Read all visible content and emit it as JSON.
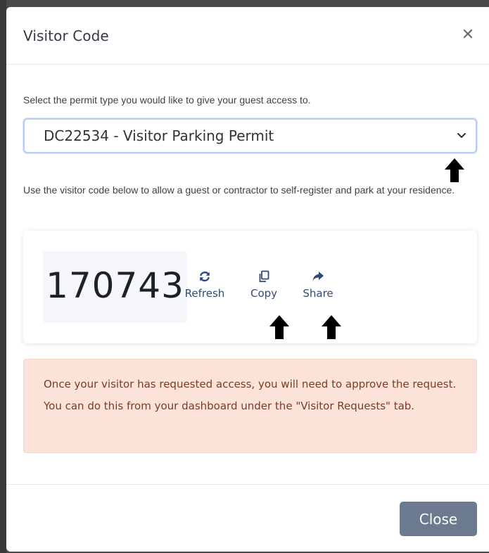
{
  "modal": {
    "title": "Visitor Code",
    "close_icon": "close-icon"
  },
  "permit": {
    "instruction": "Select the permit type you would like to give your guest access to.",
    "selected": "DC22534 - Visitor Parking Permit"
  },
  "code_section": {
    "instruction": "Use the visitor code below to allow a guest or contractor to self-register and park at your residence.",
    "code": "170743",
    "actions": [
      {
        "label": "Refresh",
        "icon": "refresh-icon"
      },
      {
        "label": "Copy",
        "icon": "copy-icon"
      },
      {
        "label": "Share",
        "icon": "share-icon"
      }
    ]
  },
  "alert": {
    "text": "Once your visitor has requested access, you will need to approve the request. You can do this from your dashboard under the \"Visitor Requests\" tab."
  },
  "footer": {
    "close_label": "Close"
  },
  "colors": {
    "primary_action": "#2f4a78",
    "alert_bg": "#fce3d9",
    "alert_text": "#7b3b24",
    "close_button": "#6c7a8f"
  }
}
